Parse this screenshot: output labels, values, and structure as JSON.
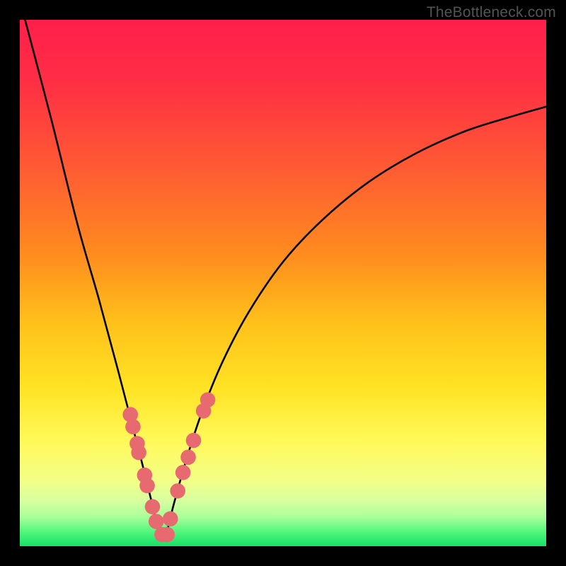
{
  "watermark": "TheBottleneck.com",
  "chart_data": {
    "type": "line",
    "title": "",
    "xlabel": "",
    "ylabel": "",
    "xlim": [
      0,
      1
    ],
    "ylim": [
      0,
      1
    ],
    "gradient_stops": [
      {
        "offset": 0.0,
        "color": "#ff1f4b"
      },
      {
        "offset": 0.12,
        "color": "#ff2f44"
      },
      {
        "offset": 0.28,
        "color": "#ff5a33"
      },
      {
        "offset": 0.44,
        "color": "#ff8a1f"
      },
      {
        "offset": 0.58,
        "color": "#ffc21a"
      },
      {
        "offset": 0.7,
        "color": "#ffe324"
      },
      {
        "offset": 0.8,
        "color": "#fff95a"
      },
      {
        "offset": 0.875,
        "color": "#f4ff87"
      },
      {
        "offset": 0.915,
        "color": "#d6ffa0"
      },
      {
        "offset": 0.945,
        "color": "#a8ff9a"
      },
      {
        "offset": 0.975,
        "color": "#4cf57a"
      },
      {
        "offset": 1.0,
        "color": "#16e06a"
      }
    ],
    "series": [
      {
        "name": "bottleneck-curve",
        "x": [
          0.01,
          0.06,
          0.11,
          0.15,
          0.185,
          0.215,
          0.235,
          0.252,
          0.265,
          0.278,
          0.292,
          0.315,
          0.345,
          0.385,
          0.435,
          0.5,
          0.575,
          0.66,
          0.75,
          0.845,
          0.93,
          1.0
        ],
        "y": [
          1.0,
          0.81,
          0.61,
          0.47,
          0.34,
          0.225,
          0.147,
          0.078,
          0.025,
          0.025,
          0.078,
          0.16,
          0.252,
          0.35,
          0.445,
          0.54,
          0.62,
          0.69,
          0.745,
          0.788,
          0.815,
          0.835
        ]
      }
    ],
    "highlight_points": {
      "name": "scatter-highlights",
      "color": "#e66a6f",
      "radius_frac": 0.0145,
      "points": [
        {
          "x": 0.21,
          "y": 0.25
        },
        {
          "x": 0.215,
          "y": 0.227
        },
        {
          "x": 0.223,
          "y": 0.195
        },
        {
          "x": 0.226,
          "y": 0.178
        },
        {
          "x": 0.237,
          "y": 0.135
        },
        {
          "x": 0.242,
          "y": 0.115
        },
        {
          "x": 0.252,
          "y": 0.075
        },
        {
          "x": 0.259,
          "y": 0.047
        },
        {
          "x": 0.27,
          "y": 0.022
        },
        {
          "x": 0.28,
          "y": 0.022
        },
        {
          "x": 0.286,
          "y": 0.052
        },
        {
          "x": 0.3,
          "y": 0.105
        },
        {
          "x": 0.31,
          "y": 0.14
        },
        {
          "x": 0.32,
          "y": 0.169
        },
        {
          "x": 0.33,
          "y": 0.201
        },
        {
          "x": 0.349,
          "y": 0.257
        },
        {
          "x": 0.357,
          "y": 0.278
        }
      ]
    }
  }
}
